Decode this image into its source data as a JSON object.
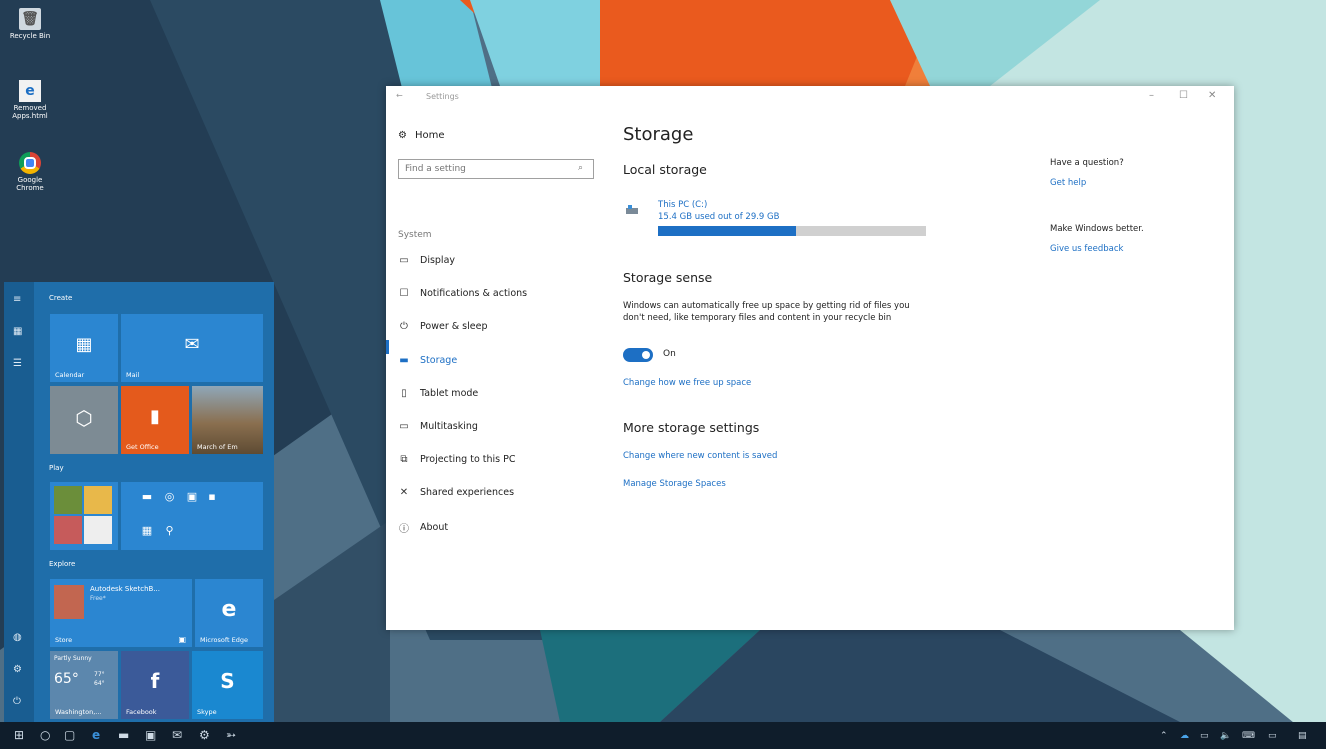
{
  "desktop": {
    "icons": [
      {
        "label": "Recycle Bin",
        "icon": "recycle-bin-icon"
      },
      {
        "label": "Removed Apps.html",
        "icon": "edge-file-icon"
      },
      {
        "label": "Google Chrome",
        "icon": "chrome-icon"
      }
    ]
  },
  "window": {
    "title": "Settings",
    "controls": {
      "minimize": "–",
      "maximize": "☐",
      "close": "✕"
    }
  },
  "nav": {
    "home": "Home",
    "search_placeholder": "Find a setting",
    "section": "System",
    "items": [
      {
        "label": "Display",
        "icon": "display-icon"
      },
      {
        "label": "Notifications & actions",
        "icon": "notifications-icon"
      },
      {
        "label": "Power & sleep",
        "icon": "power-icon"
      },
      {
        "label": "Storage",
        "icon": "storage-icon",
        "selected": true
      },
      {
        "label": "Tablet mode",
        "icon": "tablet-icon"
      },
      {
        "label": "Multitasking",
        "icon": "multitasking-icon"
      },
      {
        "label": "Projecting to this PC",
        "icon": "projecting-icon"
      },
      {
        "label": "Shared experiences",
        "icon": "shared-icon"
      },
      {
        "label": "About",
        "icon": "info-icon"
      }
    ]
  },
  "content": {
    "title": "Storage",
    "local_storage": {
      "heading": "Local storage",
      "drive_name": "This PC (C:)",
      "usage": "15.4 GB used out of 29.9 GB",
      "used_fraction": 0.515
    },
    "storage_sense": {
      "heading": "Storage sense",
      "description": "Windows can automatically free up space by getting rid of files you don't need, like temporary files and content in your recycle bin",
      "toggle_state": "On",
      "link": "Change how we free up space"
    },
    "more": {
      "heading": "More storage settings",
      "links": [
        "Change where new content is saved",
        "Manage Storage Spaces"
      ]
    },
    "side": {
      "question": "Have a question?",
      "get_help": "Get help",
      "better": "Make Windows better.",
      "feedback": "Give us feedback"
    }
  },
  "start_menu": {
    "groups": [
      "Create",
      "Play",
      "Explore"
    ],
    "tiles": {
      "calendar": "Calendar",
      "mail": "Mail",
      "get_office": "Get Office",
      "march": "March of Em",
      "store_app": "Autodesk SketchB...",
      "store_app_sub": "Free*",
      "store": "Store",
      "edge": "Microsoft Edge",
      "weather_cond": "Partly Sunny",
      "weather_temp": "65°",
      "weather_hi": "77°",
      "weather_lo": "64°",
      "weather_city": "Washington,...",
      "facebook": "Facebook",
      "skype": "Skype"
    }
  },
  "colors": {
    "accent": "#1d6fc4",
    "start_bg": "#1f6eaa",
    "taskbar": "#0f1d2b"
  }
}
